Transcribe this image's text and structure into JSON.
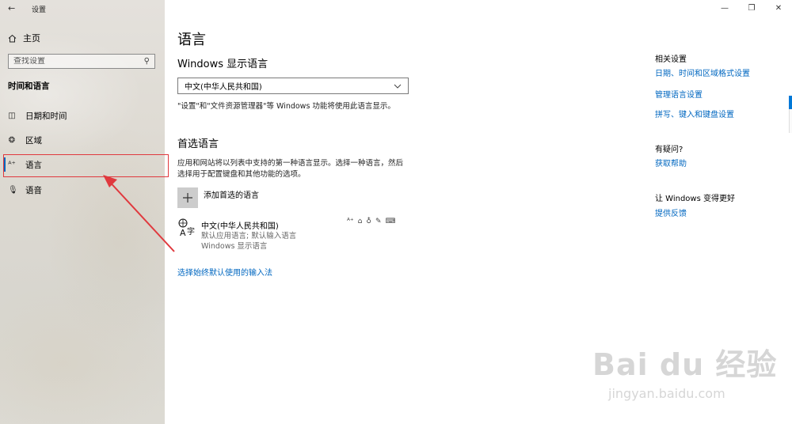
{
  "window": {
    "back_glyph": "←",
    "title": "设置",
    "minimize_glyph": "—",
    "maximize_glyph": "❐",
    "close_glyph": "✕"
  },
  "sidebar": {
    "home_label": "主页",
    "search_placeholder": "查找设置",
    "section_title": "时间和语言",
    "items": [
      {
        "label": "日期和时间",
        "icon": "calendar-clock-icon"
      },
      {
        "label": "区域",
        "icon": "globe-region-icon"
      },
      {
        "label": "语言",
        "icon": "language-icon",
        "selected": true
      },
      {
        "label": "语音",
        "icon": "microphone-icon"
      }
    ]
  },
  "main": {
    "page_title": "语言",
    "display_lang_title": "Windows 显示语言",
    "display_lang_value": "中文(中华人民共和国)",
    "display_lang_desc": "\"设置\"和\"文件资源管理器\"等 Windows 功能将使用此语言显示。",
    "preferred_title": "首选语言",
    "preferred_desc": "应用和网站将以列表中支持的第一种语言显示。选择一种语言，然后选择用于配置键盘和其他功能的选项。",
    "add_lang_label": "添加首选的语言",
    "language": {
      "name": "中文(中华人民共和国)",
      "detail1": "默认应用语言; 默认输入语言",
      "detail2": "Windows 显示语言"
    },
    "input_method_link": "选择始终默认使用的输入法"
  },
  "related": {
    "heading": "相关设置",
    "links": [
      "日期、时间和区域格式设置",
      "管理语言设置",
      "拼写、键入和键盘设置"
    ],
    "question_heading": "有疑问?",
    "help_link": "获取帮助",
    "feedback_heading": "让 Windows 变得更好",
    "feedback_link": "提供反馈"
  },
  "watermark": {
    "main": "Bai du 经验",
    "sub": "jingyan.baidu.com"
  },
  "colors": {
    "accent": "#0067c0",
    "highlight_box": "#e0393e"
  }
}
